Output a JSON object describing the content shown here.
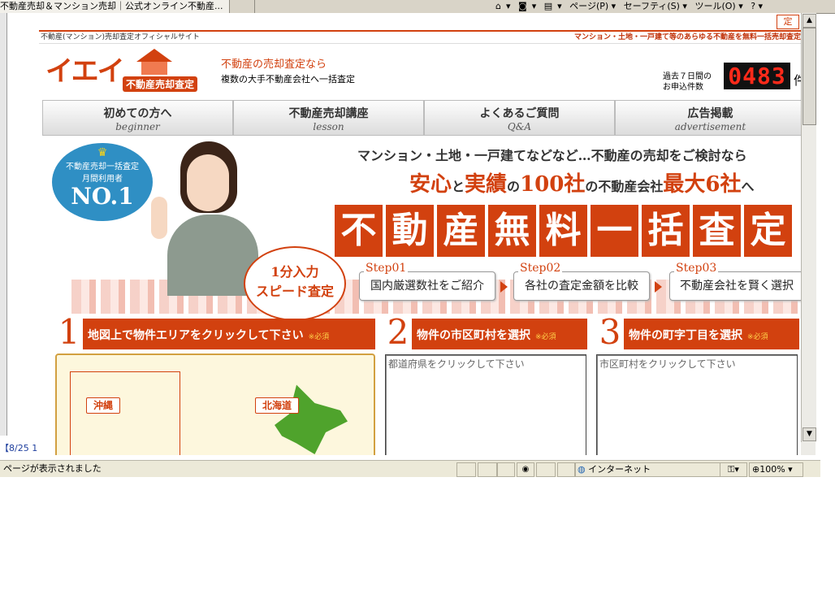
{
  "browser": {
    "tab_title": "不動産売却＆マンション売却｜公式オンライン不動産...",
    "commands": [
      "▾",
      "▾",
      "▾",
      "ページ(P) ▾",
      "セーフティ(S) ▾",
      "ツール(O) ▾",
      "? ▾"
    ]
  },
  "outer": {
    "left_bottom_text": "【8/25 1"
  },
  "page": {
    "topbar_left": "不動産(マンション)売却査定オフィシャルサイト",
    "topbar_right": "マンション・土地・一戸建て等のあらゆる不動産を無料一括売却査定",
    "logo_text": "イエイ",
    "logo_sub": "不動産売却査定",
    "tagline1": "不動産の売却査定なら",
    "tagline2": "複数の大手不動産会社へ一括査定",
    "counter_label": "過去７日間の\nお申込件数",
    "counter_value": "0483",
    "counter_unit": "件",
    "nav": [
      {
        "jp": "初めての方へ",
        "en": "beginner"
      },
      {
        "jp": "不動産売却講座",
        "en": "lesson"
      },
      {
        "jp": "よくあるご質問",
        "en": "Q&A"
      },
      {
        "jp": "広告掲載",
        "en": "advertisement"
      }
    ],
    "badge": {
      "l1": "不動産売却一括査定",
      "l2": "月間利用者",
      "l3": "NO.1"
    },
    "speed": {
      "a": "1分入力",
      "b": "スピード査定"
    },
    "headline1": "マンション・土地・一戸建てなどなど…不動産の売却をご検討なら",
    "headline2": {
      "p1": "安心",
      "p2": "と",
      "p3": "実績",
      "p4": "の",
      "p5": "100社",
      "p6": "の不動産会社",
      "p7": "最大6社",
      "p8": "へ"
    },
    "banner_chars": [
      "不",
      "動",
      "産",
      "無",
      "料",
      "一",
      "括",
      "査",
      "定"
    ],
    "steps": [
      {
        "label": "Step01",
        "text": "国内厳選数社をご紹介"
      },
      {
        "label": "Step02",
        "text": "各社の査定金額を比較"
      },
      {
        "label": "Step03",
        "text": "不動産会社を賢く選択"
      }
    ],
    "sections": [
      {
        "num": "1",
        "title": "地図上で物件エリアをクリックして下さい",
        "req": "※必須"
      },
      {
        "num": "2",
        "title": "物件の市区町村を選択",
        "req": "※必須"
      },
      {
        "num": "3",
        "title": "物件の町字丁目を選択",
        "req": "※必須"
      }
    ],
    "map": {
      "okinawa": "沖縄",
      "hokkaido": "北海道"
    },
    "list2_placeholder": "都道府県をクリックして下さい",
    "list3_placeholder": "市区町村をクリックして下さい",
    "right_tab_stub": "定"
  },
  "statusbar": {
    "text": "ページが表示されました",
    "zone": "インターネット",
    "zoom": "100%"
  },
  "colors": {
    "accent": "#d2410f",
    "badge": "#2f8fc4",
    "map_green": "#4fa32c"
  }
}
